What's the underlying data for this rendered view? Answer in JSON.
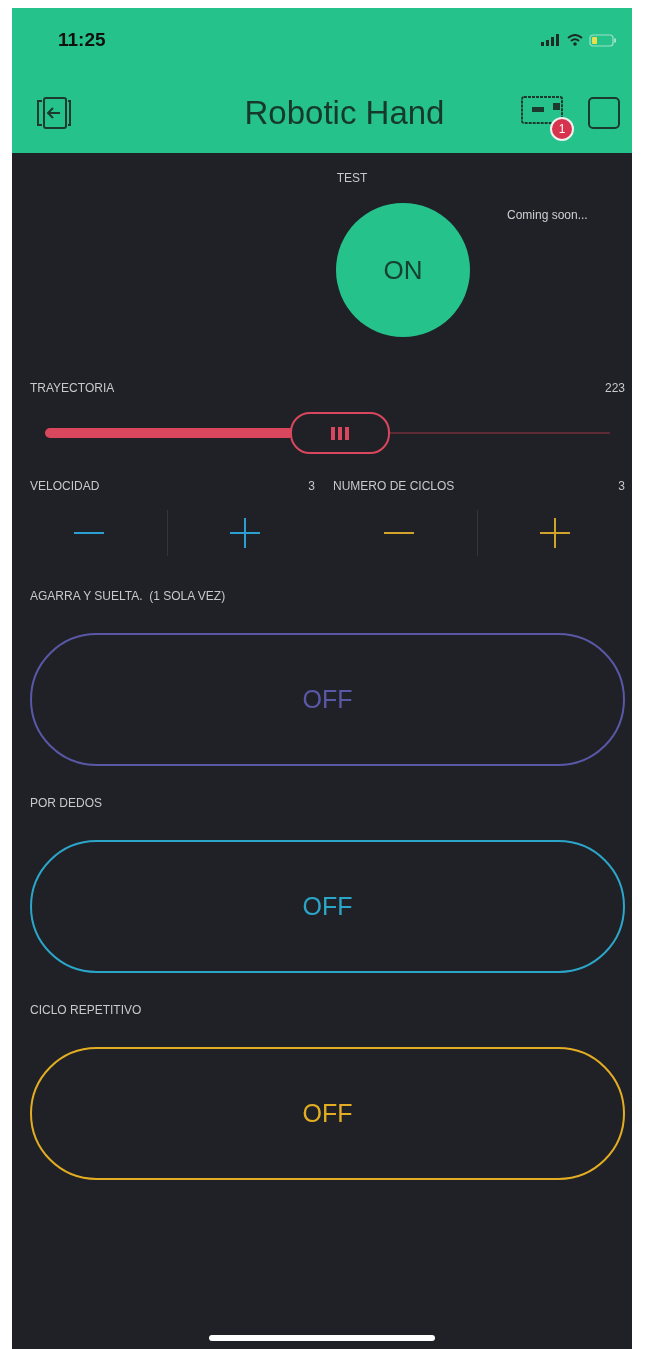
{
  "status_bar": {
    "time": "11:25"
  },
  "header": {
    "title": "Robotic Hand",
    "badge": "1"
  },
  "test": {
    "label": "TEST",
    "text": "ON",
    "on": true,
    "note": "Coming soon..."
  },
  "slider": {
    "label": "TRAYECTORIA",
    "reading": "223",
    "level": 0.44
  },
  "steppers": [
    {
      "label": "VELOCIDAD",
      "value": "3",
      "color": "#2a9fd0"
    },
    {
      "label": "NUMERO DE CICLOS",
      "value": "3",
      "color": "#d2a32a"
    }
  ],
  "switches": [
    {
      "label": "AGARRA Y SUELTA.  (1 SOLA VEZ)",
      "text": "OFF",
      "on": false,
      "color": "#5a57a6"
    },
    {
      "label": "POR DEDOS",
      "text": "OFF",
      "on": false,
      "color": "#2ba6c9"
    },
    {
      "label": "CICLO REPETITIVO",
      "text": "OFF",
      "on": false,
      "color": "#e2ad22"
    }
  ]
}
